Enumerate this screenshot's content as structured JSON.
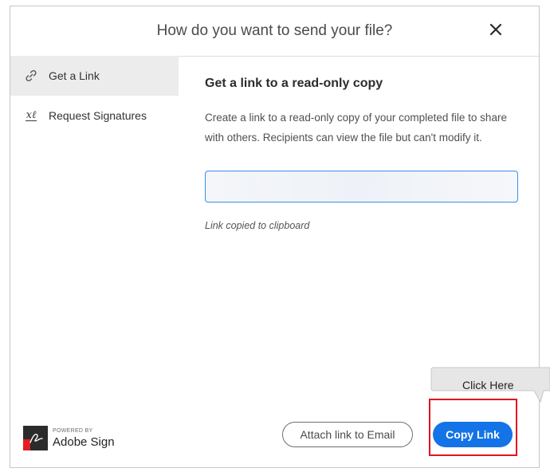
{
  "dialog": {
    "title": "How do you want to send your file?",
    "close_icon": "close-icon"
  },
  "sidebar": {
    "items": [
      {
        "label": "Get a Link",
        "icon": "link-icon",
        "active": true
      },
      {
        "label": "Request Signatures",
        "icon": "signature-icon",
        "active": false
      }
    ],
    "brand": {
      "powered_by": "POWERED BY",
      "name": "Adobe Sign",
      "icon": "adobe-sign-logo"
    }
  },
  "main": {
    "heading": "Get a link to a read-only copy",
    "description": "Create a link to a read-only copy of your completed file to share with others. Recipients can view the file but can't modify it.",
    "link_field": {
      "value": ""
    },
    "status": "Link copied to clipboard"
  },
  "footer": {
    "attach_label": "Attach link to Email",
    "copy_label": "Copy Link"
  },
  "annotation": {
    "callout": "Click Here",
    "highlight_color": "#e0141e"
  },
  "colors": {
    "accent": "#1473e6",
    "input_border": "#378ef0",
    "active_nav": "#ececec"
  }
}
